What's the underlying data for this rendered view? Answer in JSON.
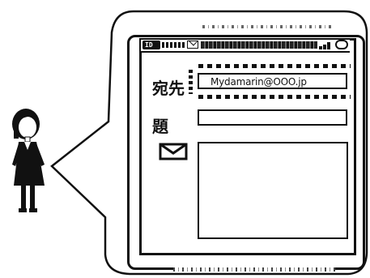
{
  "compose": {
    "to_label": "宛先",
    "subject_label": "題",
    "to_value": "Mydamarin@OOO.jp",
    "subject_value": "",
    "body_value": ""
  },
  "status_bar": {
    "left_badge": "ID",
    "icons": [
      "mail-icon",
      "signal-icon",
      "battery-icon"
    ]
  },
  "colors": {
    "ink": "#111111",
    "paper": "#ffffff"
  }
}
